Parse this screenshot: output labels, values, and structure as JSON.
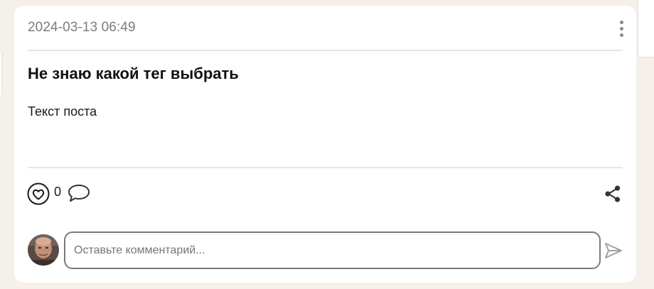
{
  "post": {
    "date": "2024-03-13 06:49",
    "title": "Не знаю какой тег выбрать",
    "body": "Текст поста",
    "likes": "0"
  },
  "icons": {
    "menu": "more-vertical-icon",
    "like": "heart-icon",
    "comment": "comment-bubble-icon",
    "share": "share-icon",
    "send": "send-icon"
  },
  "comment_form": {
    "placeholder": "Оставьте комментарий..."
  },
  "colors": {
    "page_background": "#f5f0e9",
    "card_background": "#ffffff",
    "date_text": "#7c7c7c",
    "icon": "#333333"
  }
}
